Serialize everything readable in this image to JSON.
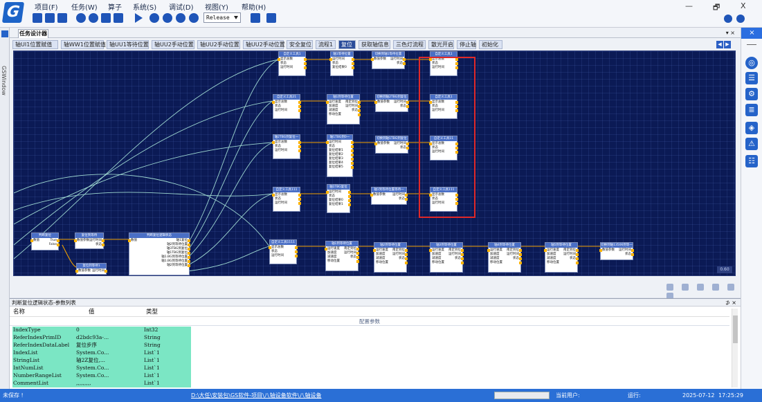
{
  "app": {
    "logo_letter": "G",
    "menu": [
      "项目(F)",
      "任务(W)",
      "算子",
      "系统(S)",
      "调试(D)",
      "视图(Y)",
      "帮助(H)"
    ],
    "build_config": "Release",
    "window_controls": [
      "—",
      "🗗",
      "X"
    ]
  },
  "left_strip": {
    "label": "GSWindow"
  },
  "designer": {
    "tab_title": "任务设计器",
    "panel_controls": "▾ ×",
    "flow_tabs": [
      {
        "label": "轴UI1位置赋值",
        "active": false
      },
      {
        "label": "轴WW1位置赋值",
        "active": false
      },
      {
        "label": "轴UU1等待位置",
        "active": false
      },
      {
        "label": "轴UU2手动位置",
        "active": false
      },
      {
        "label": "轴UU2手动位置",
        "active": false
      },
      {
        "label": "轴UU2手动位置",
        "active": false
      },
      {
        "label": "安全复位",
        "active": false
      },
      {
        "label": "流程1",
        "active": false
      },
      {
        "label": "复位",
        "active": true
      },
      {
        "label": "获取轴信息",
        "active": false
      },
      {
        "label": "三色灯流程",
        "active": false
      },
      {
        "label": "散光开启",
        "active": false
      },
      {
        "label": "停止轴",
        "active": false
      },
      {
        "label": "初始化",
        "active": false
      }
    ],
    "tab_nav": [
      "◀",
      "▶"
    ],
    "zoom_level": "0.60",
    "nodes": [
      {
        "title": "自定义工具1",
        "rows": [
          [
            "显示总数",
            ""
          ],
          [
            "状态",
            ""
          ],
          [
            "运行时间",
            ""
          ]
        ]
      },
      {
        "title": "轴1等待位置",
        "rows": [
          [
            "运行时间",
            ""
          ],
          [
            "状态",
            ""
          ],
          [
            "复位结果0",
            ""
          ]
        ]
      },
      {
        "title": "切换到轴1等待位置",
        "rows": [
          [
            "数值参数",
            "运行时间"
          ],
          [
            "",
            "状态"
          ]
        ]
      },
      {
        "title": "自定义工具1",
        "rows": [
          [
            "显示总数",
            ""
          ],
          [
            "状态",
            ""
          ],
          [
            "运行时间",
            ""
          ]
        ]
      },
      {
        "title": "自定义工具21",
        "rows": [
          [
            "显示总数",
            ""
          ],
          [
            "状态",
            ""
          ],
          [
            "运行时间",
            ""
          ]
        ]
      },
      {
        "title": "轴1到等待位置",
        "rows": [
          [
            "运行速度",
            "南定到位"
          ],
          [
            "加速度",
            "运行时间"
          ],
          [
            "减速度",
            "状态"
          ],
          [
            "移动位置",
            ""
          ]
        ]
      },
      {
        "title": "切换到轴2TBG到复位",
        "rows": [
          [
            "数值参数",
            "运行时间"
          ],
          [
            "",
            "状态"
          ]
        ]
      },
      {
        "title": "自定义工具1",
        "rows": [
          [
            "显示总数",
            ""
          ],
          [
            "状态",
            ""
          ],
          [
            "运行时间",
            ""
          ]
        ]
      },
      {
        "title": "轴2TBG到复位一",
        "rows": [
          [
            "显示总数",
            ""
          ],
          [
            "状态",
            ""
          ],
          [
            "运行时间",
            ""
          ]
        ]
      },
      {
        "title": "轴1TBG到0一",
        "rows": [
          [
            "运行时间",
            ""
          ],
          [
            "状态",
            ""
          ],
          [
            "复位结果1",
            ""
          ],
          [
            "复位结果2",
            ""
          ],
          [
            "复位结果3",
            ""
          ],
          [
            "复位结果4",
            ""
          ],
          [
            "复位结果5",
            ""
          ]
        ]
      },
      {
        "title": "切换到轴1TBG到复位",
        "rows": [
          [
            "数值参数",
            "运行时间"
          ],
          [
            "",
            "状态"
          ]
        ]
      },
      {
        "title": "自定义工具11",
        "rows": [
          [
            "显示总数",
            ""
          ],
          [
            "状态",
            ""
          ],
          [
            "运行时间",
            ""
          ]
        ]
      },
      {
        "title": "自定义工具111",
        "rows": [
          [
            "显示总数",
            ""
          ],
          [
            "状态",
            ""
          ],
          [
            "运行时间",
            ""
          ]
        ]
      },
      {
        "title": "轴1TBG复位",
        "rows": [
          [
            "运行时间",
            ""
          ],
          [
            "状态",
            ""
          ],
          [
            "复位结果0",
            ""
          ],
          [
            "复位结果1",
            ""
          ]
        ]
      },
      {
        "title": "轴1到等待位置等待一",
        "rows": [
          [
            "数值参数",
            "运行时间"
          ],
          [
            "",
            "状态"
          ]
        ]
      },
      {
        "title": "自定义工具111",
        "rows": [
          [
            "显示总数",
            ""
          ],
          [
            "状态",
            ""
          ],
          [
            "运行时间",
            ""
          ]
        ]
      },
      {
        "title": "判断复位",
        "rows": [
          [
            "数值",
            "True"
          ],
          [
            "",
            "False"
          ]
        ]
      },
      {
        "title": "复位到等待",
        "rows": [
          [
            "数值参数",
            "运行时间"
          ],
          [
            "",
            "状态"
          ]
        ]
      },
      {
        "title": "判断复位逻辑状态",
        "rows": [
          [
            "数值",
            "轴1复位"
          ],
          [
            "",
            "轴2到等待位置"
          ],
          [
            "",
            "轴3TBG到复位"
          ],
          [
            "",
            "轴1TBG到复位"
          ],
          [
            "",
            "轴1.BG到等待位置"
          ],
          [
            "",
            "轴1.BG到等待位置"
          ],
          [
            "",
            "轴2到等待位置"
          ]
        ]
      },
      {
        "title": "复位到等待1",
        "rows": [
          [
            "数值参数",
            "运行时间"
          ]
        ]
      },
      {
        "title": "自定义工具1111",
        "rows": [
          [
            "显示总数",
            ""
          ],
          [
            "状态",
            ""
          ],
          [
            "运行时间",
            ""
          ]
        ]
      },
      {
        "title": "轴1到等待位置",
        "rows": [
          [
            "运行速度",
            "南定到位"
          ],
          [
            "加速度",
            "运行时间"
          ],
          [
            "减速度",
            "状态"
          ],
          [
            "移动位置",
            ""
          ]
        ]
      },
      {
        "title": "轴2到等待位置",
        "rows": [
          [
            "运行速度",
            "南定到位"
          ],
          [
            "加速度",
            "运行时间"
          ],
          [
            "减速度",
            "状态"
          ],
          [
            "移动位置",
            ""
          ]
        ]
      },
      {
        "title": "轴3到等待位置",
        "rows": [
          [
            "运行速度",
            "南定到位"
          ],
          [
            "加速度",
            "运行时间"
          ],
          [
            "减速度",
            "状态"
          ],
          [
            "移动位置",
            ""
          ]
        ]
      },
      {
        "title": "轴4到等待位置",
        "rows": [
          [
            "运行速度",
            "南定到位"
          ],
          [
            "加速度",
            "运行时间"
          ],
          [
            "减速度",
            "状态"
          ],
          [
            "移动位置",
            ""
          ]
        ]
      },
      {
        "title": "轴5到等待位置",
        "rows": [
          [
            "运行速度",
            "南定到位"
          ],
          [
            "加速度",
            "运行时间"
          ],
          [
            "减速度",
            "状态"
          ],
          [
            "移动位置",
            ""
          ]
        ]
      },
      {
        "title": "切换到轴13506到等一",
        "rows": [
          [
            "数值参数",
            "运行时间"
          ],
          [
            "",
            "状态"
          ]
        ]
      }
    ]
  },
  "params": {
    "title": "判断复位逻辑状态-参数列表",
    "panel_controls": "⊅ ×",
    "columns": [
      "名称",
      "值",
      "类型"
    ],
    "group_label": "配置参数",
    "rows": [
      {
        "name": "IndexType",
        "value": "0",
        "type": "Int32"
      },
      {
        "name": "ReferIndexPrimID",
        "value": "d2bdc93a-...",
        "type": "String"
      },
      {
        "name": "ReferIndexDataLabel",
        "value": "复位步序",
        "type": "String"
      },
      {
        "name": "IndexList",
        "value": "System.Co...",
        "type": "List`1"
      },
      {
        "name": "StringList",
        "value": "轴2Z复位,...",
        "type": "List`1"
      },
      {
        "name": "IntNumList",
        "value": "System.Co...",
        "type": "List`1"
      },
      {
        "name": "NumberRangeList",
        "value": "System.Co...",
        "type": "List`1"
      },
      {
        "name": "CommentList",
        "value": ",,,,,,,,,",
        "type": "List`1"
      }
    ]
  },
  "status": {
    "save_state": "未保存 !",
    "project_path": "D:\\大任\\安装包\\GS软件-项目\\八轴设备软件\\八轴设备",
    "current_user_label": "当前用户:",
    "run_label": "运行:",
    "date": "2025-07-12",
    "time": "17:25:29"
  },
  "colors": {
    "canvas_bg": "#0b1a55",
    "wire_curve": "#9fd9d1",
    "wire_flow": "#f0a000",
    "param_row": "#7be6c4",
    "highlight": "#e02828",
    "brand_blue": "#2a6fd6"
  }
}
